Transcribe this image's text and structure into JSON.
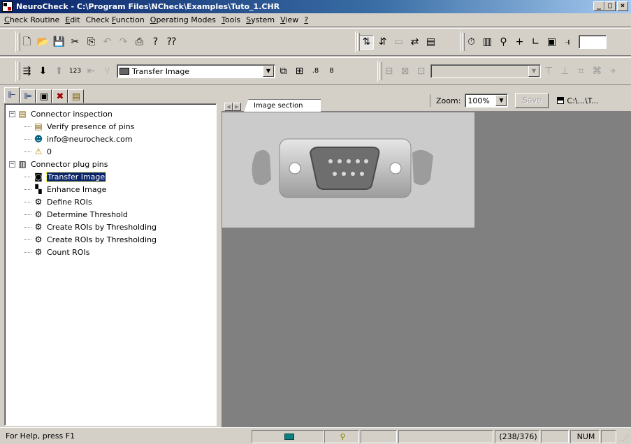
{
  "window": {
    "title": "NeuroCheck - C:\\Program Files\\NCheck\\Examples\\Tuto_1.CHR",
    "minimize": "_",
    "maximize": "□",
    "close": "×"
  },
  "menu": [
    {
      "prefix": "",
      "ul": "C",
      "rest": "heck Routine"
    },
    {
      "prefix": "",
      "ul": "E",
      "rest": "dit"
    },
    {
      "prefix": "Check ",
      "ul": "F",
      "rest": "unction"
    },
    {
      "prefix": "",
      "ul": "O",
      "rest": "perating Modes"
    },
    {
      "prefix": "",
      "ul": "T",
      "rest": "ools"
    },
    {
      "prefix": "",
      "ul": "S",
      "rest": "ystem"
    },
    {
      "prefix": "",
      "ul": "V",
      "rest": "iew"
    },
    {
      "prefix": "",
      "ul": "?",
      "rest": ""
    }
  ],
  "toolbar": {
    "function_combo_value": "Transfer Image",
    "function_combo_icon": "camera-icon"
  },
  "left_tabs": [
    "tree-view-icon",
    "function-list-icon",
    "image-view-icon",
    "tools-icon",
    "results-icon"
  ],
  "tree": {
    "items": [
      {
        "label": "Connector inspection",
        "icon": "checklist-icon",
        "level": 0,
        "expander": "−"
      },
      {
        "label": "Verify presence of pins",
        "icon": "checklist-icon",
        "level": 1
      },
      {
        "label": "info@neurocheck.com",
        "icon": "person-icon",
        "level": 1
      },
      {
        "label": "0",
        "icon": "warning-icon",
        "level": 1
      },
      {
        "label": "Connector plug pins",
        "icon": "stack-icon",
        "level": 0,
        "expander": "−"
      },
      {
        "label": "Transfer Image",
        "icon": "camera-icon",
        "level": 1,
        "selected": true
      },
      {
        "label": "Enhance Image",
        "icon": "enhance-icon",
        "level": 1
      },
      {
        "label": "Define ROIs",
        "icon": "roi-icon",
        "level": 1
      },
      {
        "label": "Determine Threshold",
        "icon": "roi-icon",
        "level": 1
      },
      {
        "label": "Create ROIs by Thresholding",
        "icon": "roi-icon",
        "level": 1
      },
      {
        "label": "Create ROIs by Thresholding",
        "icon": "roi-icon",
        "level": 1
      },
      {
        "label": "Count ROIs",
        "icon": "roi-icon",
        "level": 1
      }
    ]
  },
  "image_panel": {
    "tab_label": "Image section",
    "zoom_label": "Zoom:",
    "zoom_value": "100%",
    "save_label": "Save",
    "path_label": "C:\\...\\T..."
  },
  "status": {
    "help_text": "For Help, press F1",
    "coords": "(238/376)",
    "num": "NUM"
  },
  "colors": {
    "selection": "#0a246a",
    "panel_bg": "#808080",
    "image_bg": "#cbcbcb"
  }
}
